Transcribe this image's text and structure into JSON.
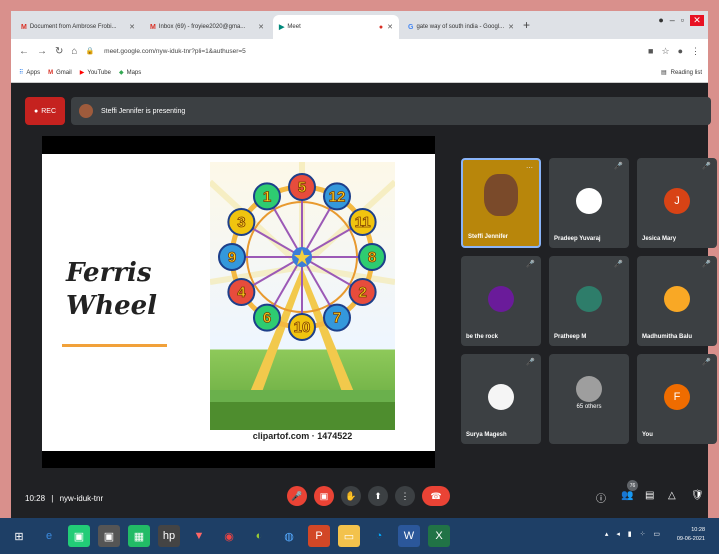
{
  "browser": {
    "tabs": [
      {
        "icon": "gmail-icon",
        "glyph": "M",
        "title": "Document from Ambrose Frobi...",
        "active": false
      },
      {
        "icon": "gmail-icon",
        "glyph": "M",
        "title": "Inbox (69) - froyiee2020@gma...",
        "active": false
      },
      {
        "icon": "meet-icon",
        "glyph": "▶",
        "title": "Meet",
        "active": true
      },
      {
        "icon": "google-icon",
        "glyph": "G",
        "title": "gate way of south india - Googl...",
        "active": false
      }
    ],
    "new_tab": "+",
    "url": "meet.google.com/nyw-iduk-tnr?pli=1&authuser=5",
    "bookmarks": [
      "Apps",
      "Gmail",
      "YouTube",
      "Maps"
    ],
    "reading_list": "Reading list"
  },
  "meet": {
    "rec_label": "REC",
    "presenting_text": "Steffi Jennifer is presenting",
    "slide": {
      "title_line1": "Ferris",
      "title_line2": "Wheel",
      "credit": "clipartof.com · 1474522",
      "wheel_numbers": [
        "5",
        "12",
        "11",
        "8",
        "2",
        "7",
        "10",
        "6",
        "4",
        "9",
        "3",
        "1"
      ]
    },
    "participants": [
      {
        "name": "Steffi Jennifer",
        "initial": "",
        "color": "#c9a227"
      },
      {
        "name": "Pradeep Yuvaraj",
        "initial": "",
        "color": "#ffffff"
      },
      {
        "name": "Jesica Mary",
        "initial": "J",
        "color": "#d84315"
      },
      {
        "name": "be the rock",
        "initial": "",
        "color": "#6a1b9a"
      },
      {
        "name": "Pratheep M",
        "initial": "",
        "color": "#2e7d6a"
      },
      {
        "name": "Madhumitha Balu",
        "initial": "",
        "color": "#f9a825"
      },
      {
        "name": "Surya Magesh",
        "initial": "",
        "color": "#f5f5f5"
      },
      {
        "name": "65 others",
        "initial": "",
        "color": "#9e9e9e"
      },
      {
        "name": "You",
        "initial": "F",
        "color": "#ef6c00"
      }
    ],
    "time": "10:28",
    "meeting_code": "nyw-iduk-tnr",
    "participant_count": "76"
  },
  "taskbar": {
    "time": "10:28",
    "date": "09-06-2021"
  }
}
